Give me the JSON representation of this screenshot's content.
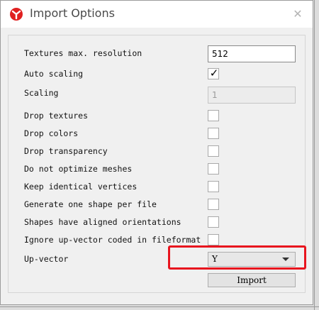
{
  "window": {
    "title": "Import Options",
    "close_glyph": "✕",
    "app_icon": "app-logo-icon"
  },
  "options": {
    "textures_max_resolution": {
      "label": "Textures max. resolution",
      "value": "512"
    },
    "auto_scaling": {
      "label": "Auto scaling",
      "checked": true,
      "mark": "✓"
    },
    "scaling": {
      "label": "Scaling",
      "value": "1",
      "disabled": true
    },
    "drop_textures": {
      "label": "Drop textures",
      "checked": false
    },
    "drop_colors": {
      "label": "Drop colors",
      "checked": false
    },
    "drop_transparency": {
      "label": "Drop transparency",
      "checked": false
    },
    "do_not_optimize_meshes": {
      "label": "Do not optimize meshes",
      "checked": false
    },
    "keep_identical_vertices": {
      "label": "Keep identical vertices",
      "checked": false
    },
    "generate_one_shape_per_file": {
      "label": "Generate one shape per file",
      "checked": false
    },
    "shapes_aligned_orientations": {
      "label": "Shapes have aligned orientations",
      "checked": false
    },
    "ignore_up_vector": {
      "label": "Ignore up-vector coded in fileformat",
      "checked": false
    },
    "up_vector": {
      "label": "Up-vector",
      "selected": "Y"
    }
  },
  "actions": {
    "import_label": "Import"
  },
  "colors": {
    "highlight": "#e8141e",
    "logo_red": "#e02020"
  }
}
